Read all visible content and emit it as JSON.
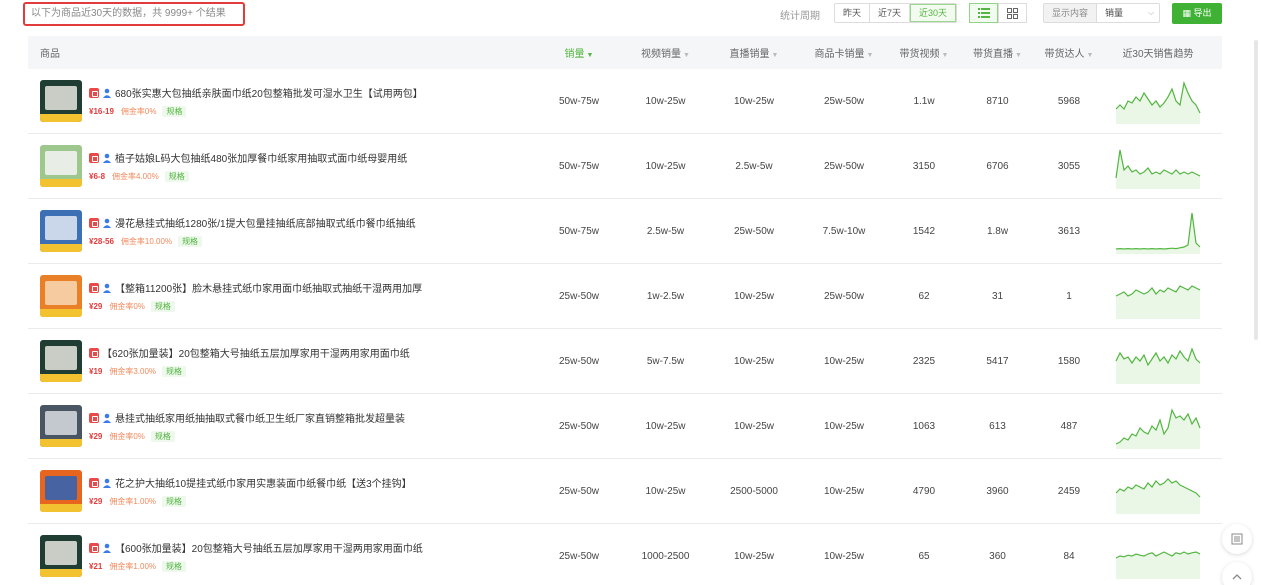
{
  "summary": "以下为商品近30天的数据，共 9999+ 个结果",
  "period": {
    "label": "统计周期",
    "options": [
      "昨天",
      "近7天",
      "近30天"
    ],
    "active": 2
  },
  "display": {
    "label": "显示内容",
    "value": "销量"
  },
  "export_label": "导出",
  "columns": {
    "product": "商品",
    "sales": "销量",
    "video_sales": "视频销量",
    "live_sales": "直播销量",
    "card_sales": "商品卡销量",
    "bring_video": "带货视频",
    "bring_live": "带货直播",
    "bring_talent": "带货达人",
    "trend": "近30天销售趋势"
  },
  "colors": {
    "accent": "#52b640",
    "price": "#e23b3b",
    "commission": "#f08a5d"
  },
  "rows": [
    {
      "title": "680张实惠大包抽纸亲肤面巾纸20包整箱批发可湿水卫生【试用两包】",
      "price": "¥16-19",
      "commission": "佣金率0%",
      "spec": "规格",
      "verified": true,
      "sales": "50w-75w",
      "video_sales": "10w-25w",
      "live_sales": "10w-25w",
      "card_sales": "25w-50w",
      "bring_video": "1.1w",
      "bring_live": "8710",
      "bring_talent": "5968",
      "trend": [
        0.3,
        0.4,
        0.3,
        0.5,
        0.45,
        0.6,
        0.5,
        0.7,
        0.55,
        0.4,
        0.5,
        0.35,
        0.45,
        0.6,
        0.8,
        0.5,
        0.4,
        0.95,
        0.7,
        0.5,
        0.4,
        0.2
      ],
      "thumb": {
        "bg": "#1f3d33",
        "accent": "#e8e6df"
      }
    },
    {
      "title": "植子姑娘L码大包抽纸480张加厚餐巾纸家用抽取式面巾纸母婴用纸",
      "price": "¥6-8",
      "commission": "佣金率4.00%",
      "spec": "规格",
      "verified": true,
      "sales": "50w-75w",
      "video_sales": "10w-25w",
      "live_sales": "2.5w-5w",
      "card_sales": "25w-50w",
      "bring_video": "3150",
      "bring_live": "6706",
      "bring_talent": "3055",
      "trend": [
        0.2,
        0.9,
        0.4,
        0.5,
        0.35,
        0.4,
        0.3,
        0.35,
        0.45,
        0.3,
        0.35,
        0.3,
        0.4,
        0.35,
        0.3,
        0.4,
        0.3,
        0.35,
        0.3,
        0.35,
        0.3,
        0.25
      ],
      "thumb": {
        "bg": "#9ec78e",
        "accent": "#f4f4f4"
      }
    },
    {
      "title": "漫花悬挂式抽纸1280张/1提大包量挂抽纸底部抽取式纸巾餐巾纸抽纸",
      "price": "¥28-56",
      "commission": "佣金率10.00%",
      "spec": "规格",
      "verified": true,
      "sales": "50w-75w",
      "video_sales": "2.5w-5w",
      "live_sales": "25w-50w",
      "card_sales": "7.5w-10w",
      "bring_video": "1542",
      "bring_live": "1.8w",
      "bring_talent": "3613",
      "trend": [
        0.05,
        0.06,
        0.05,
        0.06,
        0.05,
        0.06,
        0.05,
        0.06,
        0.05,
        0.06,
        0.05,
        0.06,
        0.05,
        0.06,
        0.07,
        0.06,
        0.08,
        0.1,
        0.15,
        0.95,
        0.2,
        0.1
      ],
      "thumb": {
        "bg": "#3d6fb5",
        "accent": "#e3eaf4"
      }
    },
    {
      "title": "【整箱11200张】脸木悬挂式纸巾家用面巾纸抽取式抽纸干湿两用加厚",
      "price": "¥29",
      "commission": "佣金率0%",
      "spec": "规格",
      "verified": true,
      "sales": "25w-50w",
      "video_sales": "1w-2.5w",
      "live_sales": "10w-25w",
      "card_sales": "25w-50w",
      "bring_video": "62",
      "bring_live": "31",
      "bring_talent": "1",
      "trend": [
        0.5,
        0.55,
        0.6,
        0.5,
        0.55,
        0.65,
        0.6,
        0.55,
        0.6,
        0.7,
        0.55,
        0.65,
        0.6,
        0.7,
        0.65,
        0.6,
        0.75,
        0.7,
        0.65,
        0.75,
        0.7,
        0.65
      ],
      "thumb": {
        "bg": "#e97f26",
        "accent": "#f7d8b5"
      }
    },
    {
      "title": "【620张加量装】20包整箱大号抽纸五层加厚家用干湿两用家用面巾纸",
      "price": "¥19",
      "commission": "佣金率3.00%",
      "spec": "规格",
      "verified": false,
      "sales": "25w-50w",
      "video_sales": "5w-7.5w",
      "live_sales": "10w-25w",
      "card_sales": "10w-25w",
      "bring_video": "2325",
      "bring_live": "5417",
      "bring_talent": "1580",
      "trend": [
        0.5,
        0.7,
        0.55,
        0.6,
        0.45,
        0.6,
        0.5,
        0.65,
        0.4,
        0.55,
        0.7,
        0.5,
        0.6,
        0.45,
        0.65,
        0.55,
        0.75,
        0.6,
        0.5,
        0.8,
        0.55,
        0.45
      ],
      "thumb": {
        "bg": "#1f3d33",
        "accent": "#e8e6df"
      }
    },
    {
      "title": "悬挂式抽纸家用纸抽抽取式餐巾纸卫生纸厂家直销整箱批发超量装",
      "price": "¥29",
      "commission": "佣金率0%",
      "spec": "规格",
      "verified": true,
      "sales": "25w-50w",
      "video_sales": "10w-25w",
      "live_sales": "10w-25w",
      "card_sales": "10w-25w",
      "bring_video": "1063",
      "bring_live": "613",
      "bring_talent": "487",
      "trend": [
        0.05,
        0.1,
        0.2,
        0.15,
        0.3,
        0.25,
        0.45,
        0.35,
        0.3,
        0.5,
        0.4,
        0.65,
        0.3,
        0.45,
        0.9,
        0.7,
        0.75,
        0.65,
        0.8,
        0.55,
        0.7,
        0.45
      ],
      "thumb": {
        "bg": "#4a5563",
        "accent": "#d9dde2"
      }
    },
    {
      "title": "花之护大抽纸10提挂式纸巾家用实惠装面巾纸餐巾纸【送3个挂钩】",
      "price": "¥29",
      "commission": "佣金率1.00%",
      "spec": "规格",
      "verified": true,
      "sales": "25w-50w",
      "video_sales": "10w-25w",
      "live_sales": "2500-5000",
      "card_sales": "10w-25w",
      "bring_video": "4790",
      "bring_live": "3960",
      "bring_talent": "2459",
      "trend": [
        0.45,
        0.55,
        0.5,
        0.6,
        0.55,
        0.65,
        0.6,
        0.55,
        0.7,
        0.6,
        0.75,
        0.65,
        0.7,
        0.8,
        0.7,
        0.75,
        0.65,
        0.6,
        0.55,
        0.5,
        0.45,
        0.35
      ],
      "thumb": {
        "bg": "#e8651f",
        "accent": "#2a63b8"
      }
    },
    {
      "title": "【600张加量装】20包整箱大号抽纸五层加厚家用干湿两用家用面巾纸",
      "price": "¥21",
      "commission": "佣金率1.00%",
      "spec": "规格",
      "verified": true,
      "sales": "25w-50w",
      "video_sales": "1000-2500",
      "live_sales": "10w-25w",
      "card_sales": "10w-25w",
      "bring_video": "65",
      "bring_live": "360",
      "bring_talent": "84",
      "trend": [
        0.45,
        0.5,
        0.48,
        0.52,
        0.5,
        0.55,
        0.52,
        0.5,
        0.55,
        0.58,
        0.5,
        0.55,
        0.6,
        0.55,
        0.5,
        0.58,
        0.55,
        0.6,
        0.55,
        0.58,
        0.6,
        0.55
      ],
      "thumb": {
        "bg": "#1f3d33",
        "accent": "#e8e6df"
      }
    }
  ]
}
